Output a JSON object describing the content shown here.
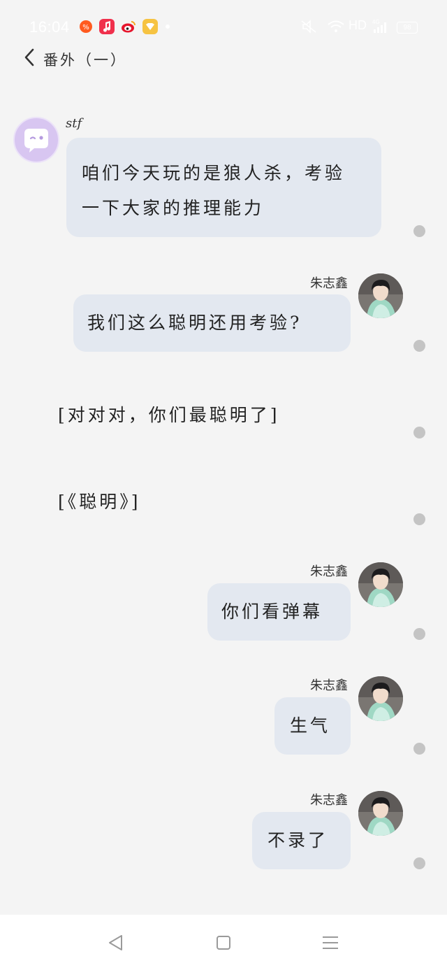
{
  "status_bar": {
    "time": "16:04",
    "network": "HD",
    "signal": "4G",
    "battery": "98",
    "icons": [
      "taobao-app-icon",
      "music-app-icon",
      "weibo-app-icon",
      "wallet-app-icon",
      "notification-dot-icon",
      "mute-icon",
      "wifi-icon",
      "signal-icon",
      "battery-icon"
    ]
  },
  "header": {
    "title": "番外（一）"
  },
  "messages": [
    {
      "type": "left",
      "sender": "stf",
      "lines": [
        "咱们今天玩的是狼人杀，考验",
        "一下大家的推理能力"
      ]
    },
    {
      "type": "right",
      "sender": "朱志鑫",
      "lines": [
        "我们这么聪明还用考验?"
      ]
    },
    {
      "type": "narration",
      "text": "[对对对，你们最聪明了]"
    },
    {
      "type": "narration",
      "text": "[《聪明》]"
    },
    {
      "type": "right",
      "sender": "朱志鑫",
      "lines": [
        "你们看弹幕"
      ]
    },
    {
      "type": "right",
      "sender": "朱志鑫",
      "lines": [
        "生气"
      ]
    },
    {
      "type": "right",
      "sender": "朱志鑫",
      "lines": [
        "不录了"
      ]
    }
  ],
  "nav_bar": {
    "icons": [
      "back-triangle-icon",
      "home-square-icon",
      "menu-lines-icon"
    ]
  },
  "colors": {
    "background": "#f4f4f4",
    "bubble": "#e3e8f0",
    "dot": "#c4c4c4",
    "avatar_left": "#d8c6f1"
  }
}
